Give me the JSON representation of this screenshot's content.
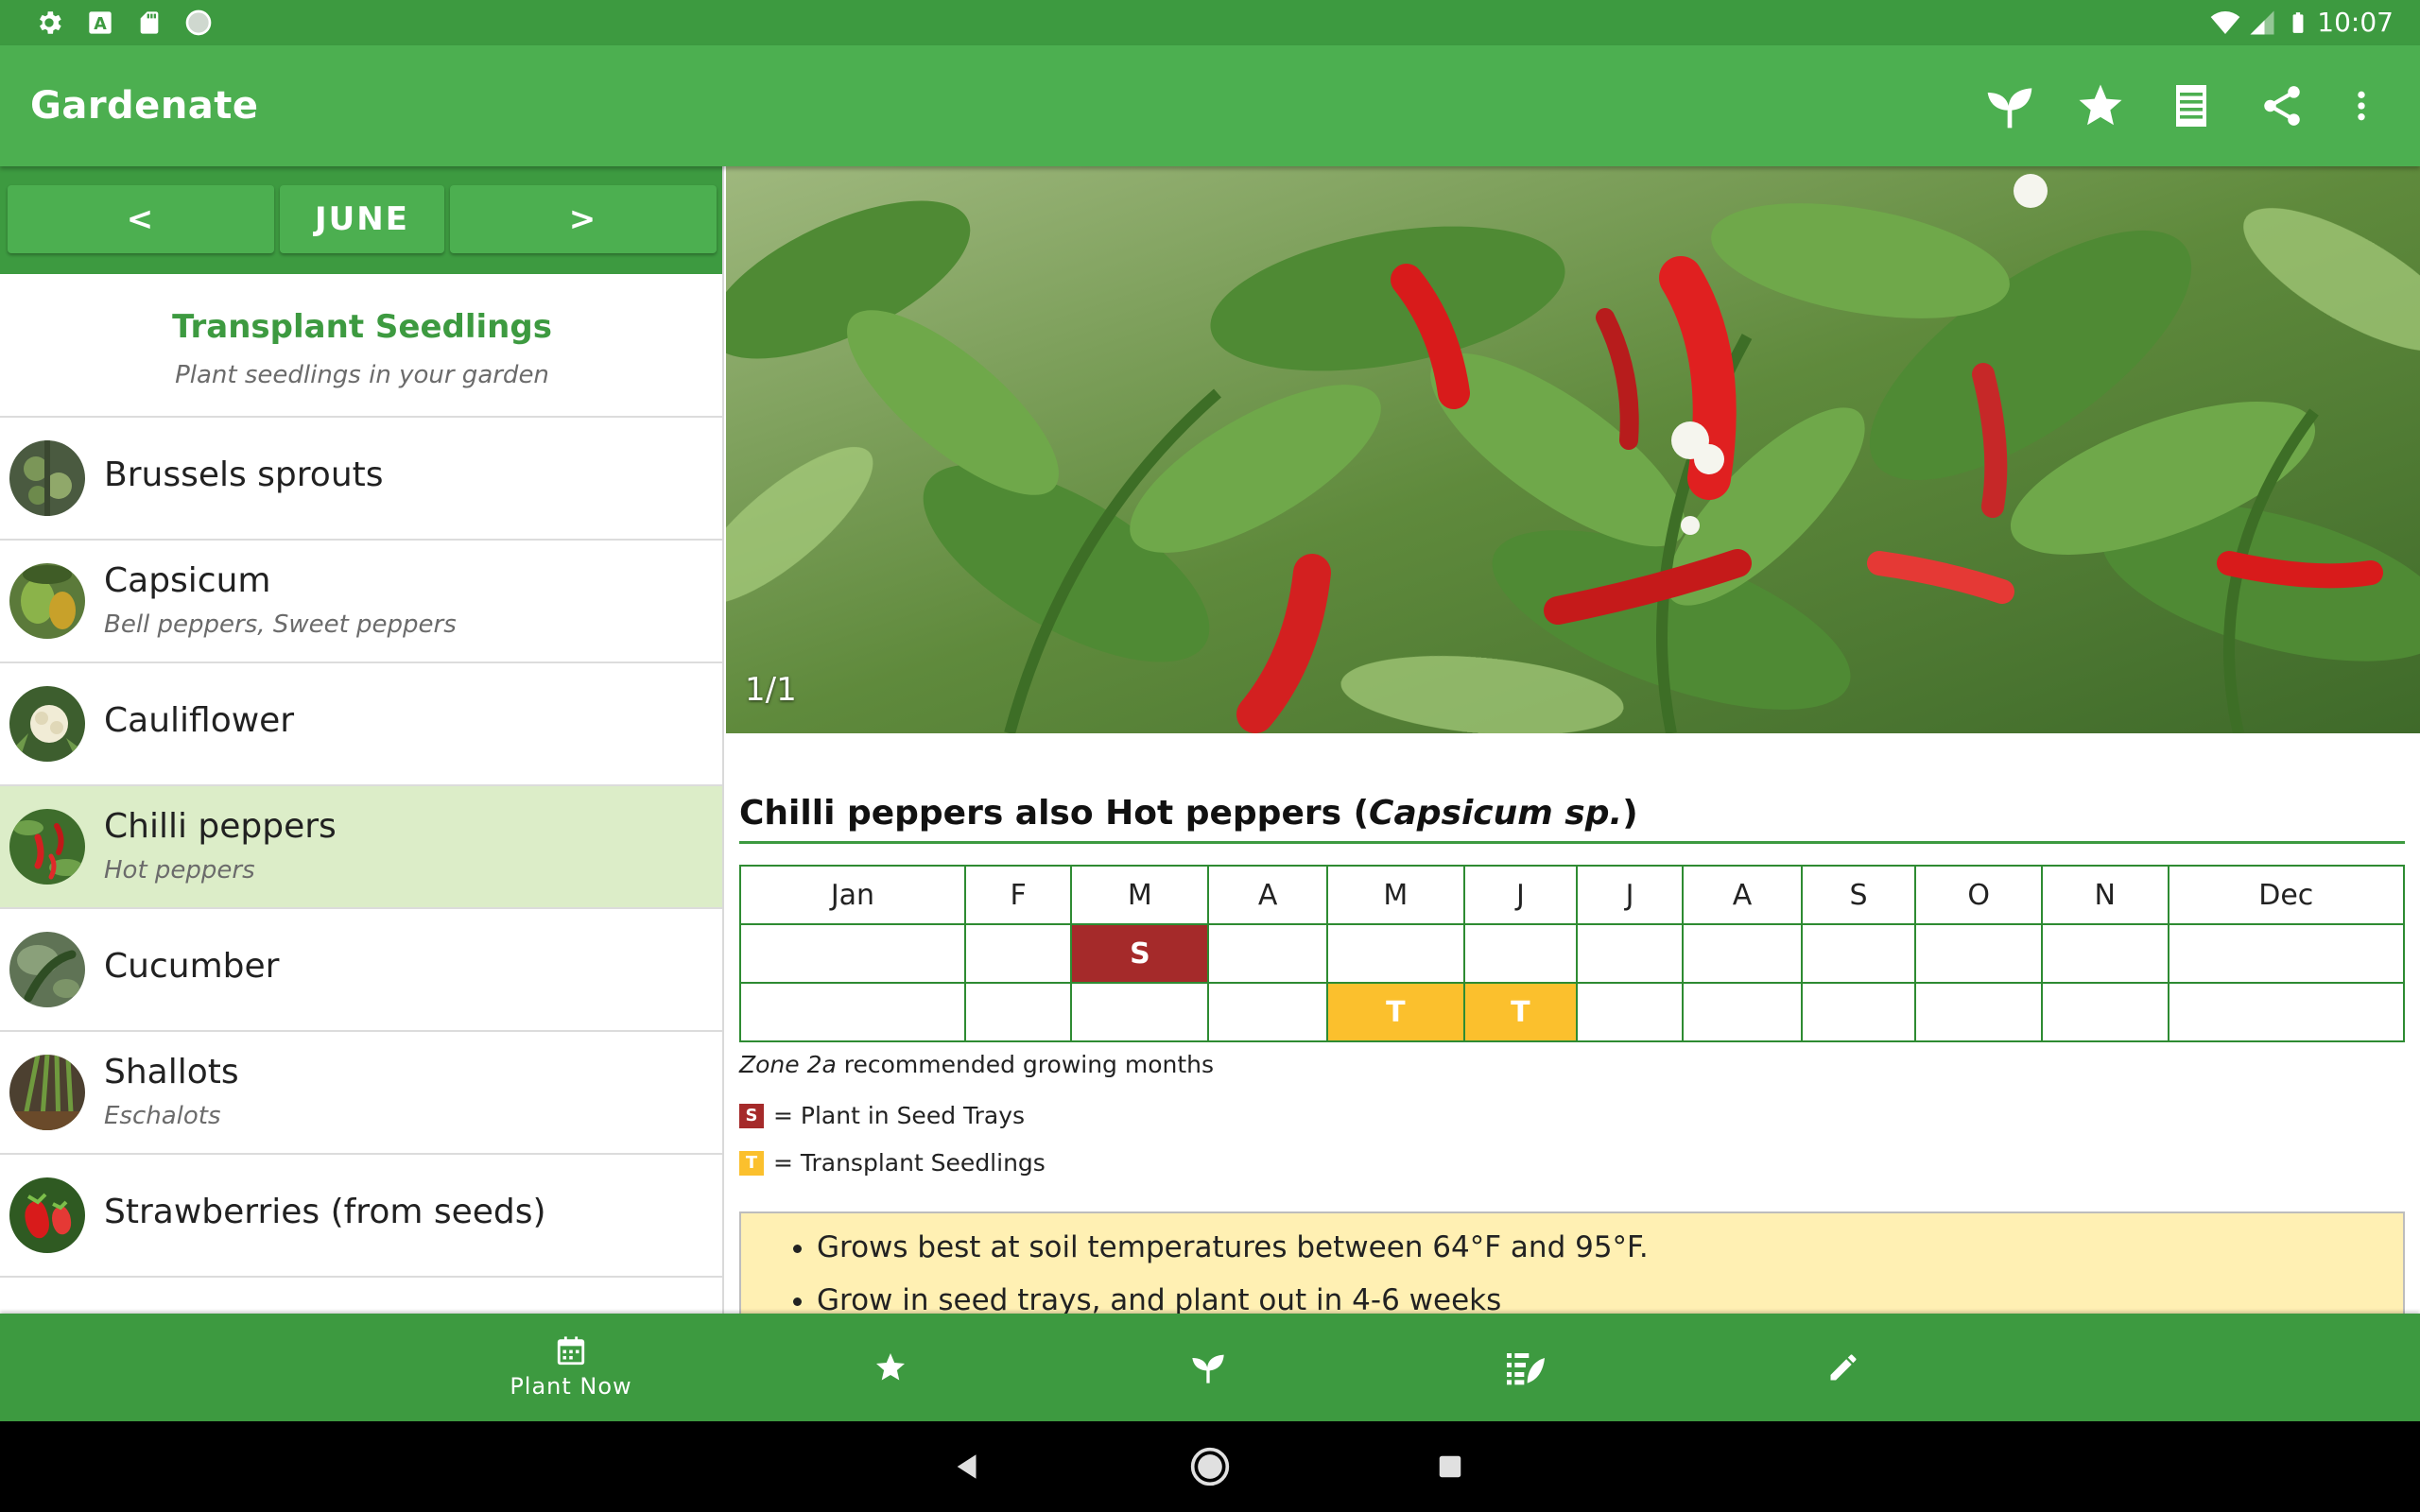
{
  "status_bar": {
    "time": "10:07",
    "left_icons": [
      "gear-icon",
      "a-box-icon",
      "sd-card-icon",
      "circle-icon"
    ],
    "right_icons": [
      "wifi-icon",
      "signal-icon",
      "battery-icon"
    ]
  },
  "app_bar": {
    "title": "Gardenate",
    "actions": [
      "sprout-icon",
      "star-icon",
      "list-icon",
      "share-icon",
      "more-vert-icon"
    ]
  },
  "month_nav": {
    "prev_label": "<",
    "month_label": "JUNE",
    "next_label": ">"
  },
  "section": {
    "title": "Transplant Seedlings",
    "subtitle": "Plant seedlings in your garden"
  },
  "plants": [
    {
      "name": "Brussels sprouts",
      "alt": "",
      "selected": false
    },
    {
      "name": "Capsicum",
      "alt": "Bell peppers, Sweet peppers",
      "selected": false
    },
    {
      "name": "Cauliflower",
      "alt": "",
      "selected": false
    },
    {
      "name": "Chilli peppers",
      "alt": "Hot peppers",
      "selected": true
    },
    {
      "name": "Cucumber",
      "alt": "",
      "selected": false
    },
    {
      "name": "Shallots",
      "alt": "Eschalots",
      "selected": false
    },
    {
      "name": "Strawberries (from seeds)",
      "alt": "",
      "selected": false
    }
  ],
  "detail": {
    "photo_counter": "1/1",
    "title_prefix": "Chilli peppers also Hot peppers (",
    "title_sci": "Capsicum sp.",
    "title_suffix": ")",
    "months": [
      "Jan",
      "F",
      "M",
      "A",
      "M",
      "J",
      "J",
      "A",
      "S",
      "O",
      "N",
      "Dec"
    ],
    "seed_row": [
      "",
      "",
      "S",
      "",
      "",
      "",
      "",
      "",
      "",
      "",
      "",
      ""
    ],
    "transplant_row": [
      "",
      "",
      "",
      "",
      "T",
      "T",
      "",
      "",
      "",
      "",
      "",
      ""
    ],
    "zone": "Zone 2a",
    "zone_text": "recommended growing months",
    "legend_s_box": "S",
    "legend_s": "= Plant in Seed Trays",
    "legend_t_box": "T",
    "legend_t": "= Transplant Seedlings",
    "tips": [
      "Grows best at soil temperatures between 64°F and 95°F.",
      "Grow in seed trays, and plant out in 4-6 weeks"
    ],
    "colors": {
      "seed": "#a52a2a",
      "transplant": "#fbc02d",
      "tips_bg": "#fff0b3"
    }
  },
  "bottom_nav": {
    "plant_now_label": "Plant Now",
    "items": [
      "calendar-icon",
      "star-icon",
      "sprout-icon",
      "list-leaf-icon",
      "pencil-icon"
    ]
  },
  "colors": {
    "primary": "#4caf50",
    "primary_dark": "#3d9a40",
    "selected_row": "#dcedc8"
  }
}
